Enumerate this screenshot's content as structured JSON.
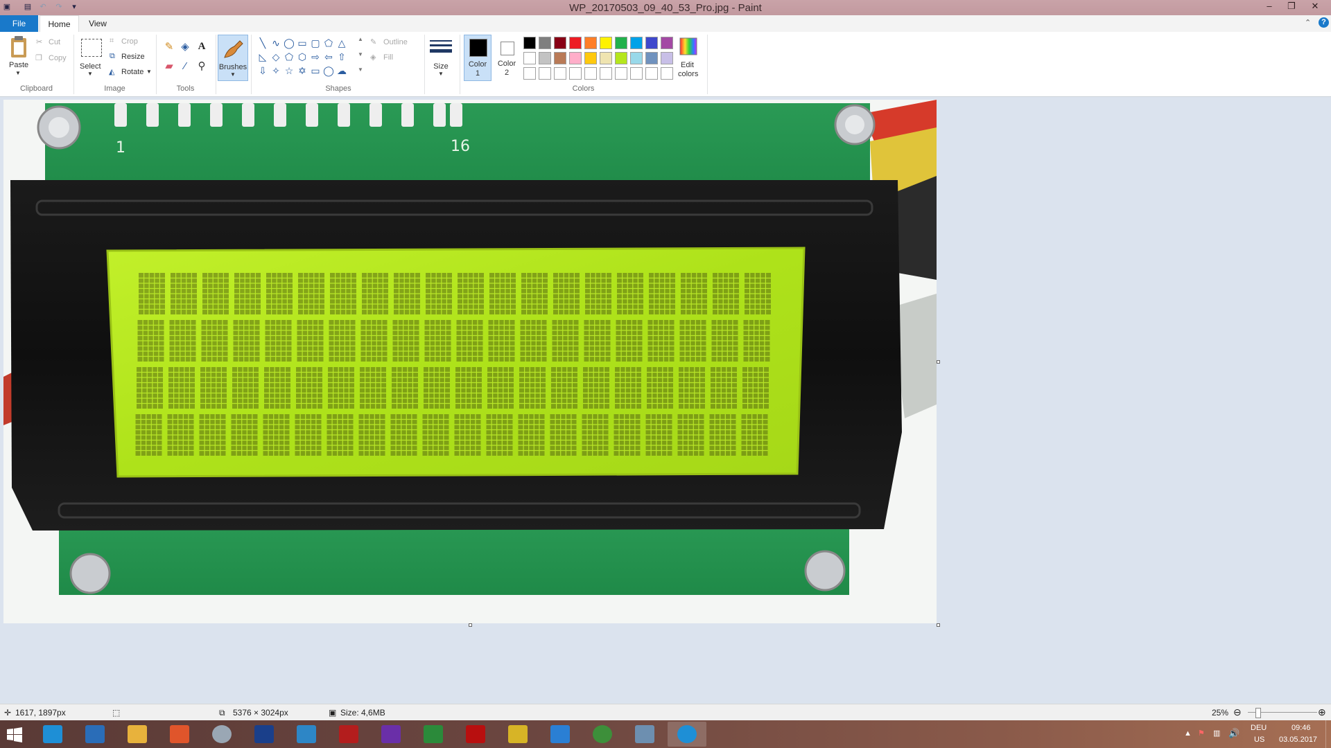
{
  "window": {
    "title": "WP_20170503_09_40_53_Pro.jpg - Paint",
    "minimize": "–",
    "restore": "❐",
    "close": "✕"
  },
  "tabs": {
    "file": "File",
    "home": "Home",
    "view": "View"
  },
  "clipboard": {
    "paste": "Paste",
    "cut": "Cut",
    "copy": "Copy",
    "label": "Clipboard"
  },
  "image": {
    "select": "Select",
    "crop": "Crop",
    "resize": "Resize",
    "rotate": "Rotate",
    "label": "Image"
  },
  "tools": {
    "label": "Tools"
  },
  "brushes": {
    "label": "Brushes"
  },
  "shapes": {
    "outline": "Outline",
    "fill": "Fill",
    "label": "Shapes"
  },
  "size": {
    "label": "Size"
  },
  "colors": {
    "color1": "Color",
    "color1_num": "1",
    "color2": "Color",
    "color2_num": "2",
    "edit": "Edit",
    "edit2": "colors",
    "label": "Colors",
    "row1": [
      "#000000",
      "#7f7f7f",
      "#880015",
      "#ed1c24",
      "#ff7f27",
      "#fff200",
      "#22b14c",
      "#00a2e8",
      "#3f48cc",
      "#a349a4"
    ],
    "row2": [
      "#ffffff",
      "#c3c3c3",
      "#b97a57",
      "#ffaec9",
      "#ffc90e",
      "#efe4b0",
      "#b5e61d",
      "#99d9ea",
      "#7092be",
      "#c8bfe7"
    ]
  },
  "photo": {
    "pcb_label_1": "1",
    "pcb_label_16": "16"
  },
  "status": {
    "cursor": "1617, 1897px",
    "dimensions": "5376 × 3024px",
    "size": "Size: 4,6MB",
    "zoom": "25%"
  },
  "tray": {
    "lang1": "DEU",
    "lang2": "US",
    "time": "09:46",
    "date": "03.05.2017"
  },
  "taskbar_colors": [
    "#1e8fd6",
    "#2a6db8",
    "#e8b23c",
    "#e0552b",
    "#9aa7b4",
    "#1a3f8a",
    "#2d86c6",
    "#b31d1d",
    "#6a2fa8",
    "#2b8a3a",
    "#b80f0f",
    "#d7b426",
    "#2a7fd4",
    "#3d8f3a",
    "#6d8fb0"
  ]
}
